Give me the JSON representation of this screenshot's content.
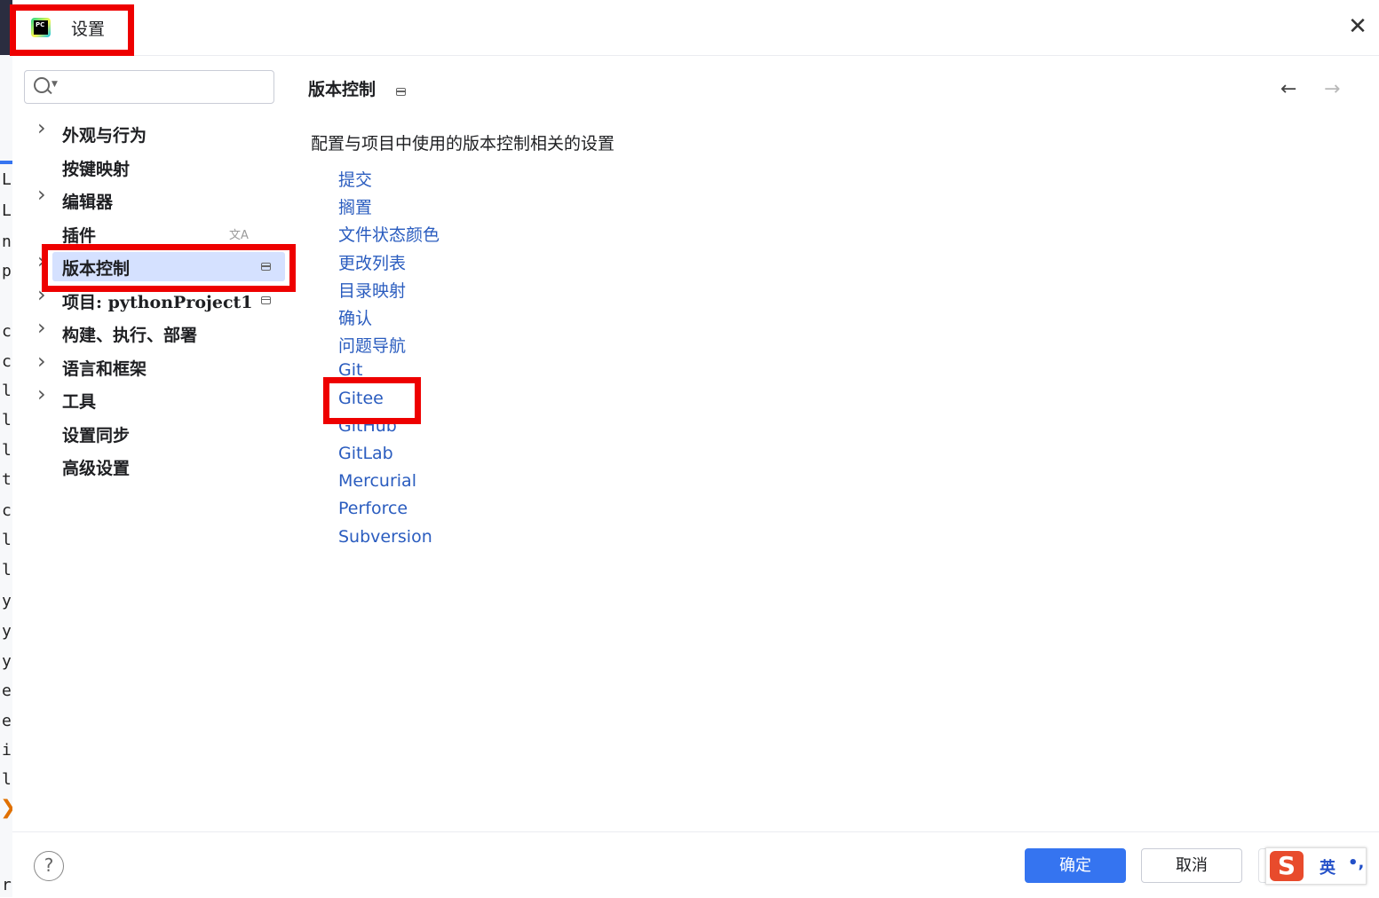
{
  "window": {
    "title": "设置",
    "close_glyph": "✕"
  },
  "left_strip": {
    "chars": [
      "L",
      "L",
      "n",
      "p",
      "c",
      "c",
      "l",
      "l",
      "l",
      "t",
      "c",
      "l",
      "l",
      "y",
      "y",
      "y",
      "e",
      "e",
      "i",
      "l",
      "ra"
    ]
  },
  "search": {
    "value": "",
    "placeholder": ""
  },
  "sidebar": {
    "items": [
      {
        "label": "外观与行为",
        "expandable": true
      },
      {
        "label": "按键映射",
        "expandable": false
      },
      {
        "label": "编辑器",
        "expandable": true
      },
      {
        "label": "插件",
        "expandable": false,
        "icon": "translate-icon"
      },
      {
        "label": "版本控制",
        "expandable": true,
        "selected": true,
        "icon": "project-level-icon"
      },
      {
        "label": "项目: pythonProject1",
        "expandable": true,
        "icon": "project-level-icon"
      },
      {
        "label": "构建、执行、部署",
        "expandable": true
      },
      {
        "label": "语言和框架",
        "expandable": true
      },
      {
        "label": "工具",
        "expandable": true
      },
      {
        "label": "设置同步",
        "expandable": false
      },
      {
        "label": "高级设置",
        "expandable": false
      }
    ]
  },
  "content": {
    "title": "版本控制",
    "description": "配置与项目中使用的版本控制相关的设置",
    "back_glyph": "←",
    "forward_glyph": "→",
    "links": [
      "提交",
      "搁置",
      "文件状态颜色",
      "更改列表",
      "目录映射",
      "确认",
      "问题导航",
      "Git",
      "Gitee",
      "GitHub",
      "GitLab",
      "Mercurial",
      "Perforce",
      "Subversion"
    ]
  },
  "footer": {
    "help": "?",
    "ok": "确定",
    "cancel": "取消",
    "apply": ""
  },
  "ime": {
    "logo": "S",
    "lang": "英",
    "punct": "•,"
  },
  "colors": {
    "accent": "#3574f0",
    "link": "#2a5cbf",
    "highlight": "#ee0000",
    "selected_bg": "#d5e1ff"
  }
}
